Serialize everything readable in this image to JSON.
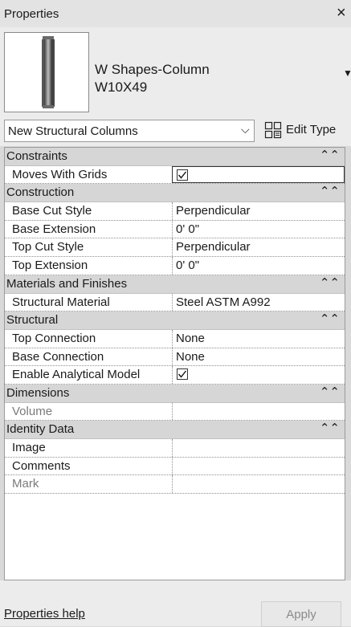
{
  "window": {
    "title": "Properties",
    "close_glyph": "×"
  },
  "type_selector": {
    "family": "W Shapes-Column",
    "type": "W10X49",
    "thumbnail_icon": "steel-column-icon",
    "arrow": "▼"
  },
  "filter": {
    "label": "New Structural Columns",
    "chevron": "⌵"
  },
  "edit_type": {
    "label": "Edit Type",
    "icon": "edit-type-icon"
  },
  "categories": [
    {
      "key": "constraints",
      "label": "Constraints",
      "collapse_glyph": "⌃⌃"
    },
    {
      "key": "construction",
      "label": "Construction",
      "collapse_glyph": "⌃⌃"
    },
    {
      "key": "materials",
      "label": "Materials and Finishes",
      "collapse_glyph": "⌃⌃"
    },
    {
      "key": "structural",
      "label": "Structural",
      "collapse_glyph": "⌃⌃"
    },
    {
      "key": "dimensions",
      "label": "Dimensions",
      "collapse_glyph": "⌃⌃"
    },
    {
      "key": "identity",
      "label": "Identity Data",
      "collapse_glyph": "⌃⌃"
    }
  ],
  "properties": {
    "moves_with_grids": {
      "name": "Moves With Grids",
      "checked": true
    },
    "base_cut_style": {
      "name": "Base Cut Style",
      "value": "Perpendicular"
    },
    "base_extension": {
      "name": "Base Extension",
      "value": "0'  0\""
    },
    "top_cut_style": {
      "name": "Top Cut Style",
      "value": "Perpendicular"
    },
    "top_extension": {
      "name": "Top Extension",
      "value": "0'  0\""
    },
    "structural_material": {
      "name": "Structural Material",
      "value": "Steel ASTM A992"
    },
    "top_connection": {
      "name": "Top Connection",
      "value": "None"
    },
    "base_connection": {
      "name": "Base Connection",
      "value": "None"
    },
    "enable_analytical_model": {
      "name": "Enable Analytical Model",
      "checked": true
    },
    "volume": {
      "name": "Volume",
      "value": ""
    },
    "image": {
      "name": "Image",
      "value": ""
    },
    "comments": {
      "name": "Comments",
      "value": ""
    },
    "mark": {
      "name": "Mark",
      "value": ""
    }
  },
  "footer": {
    "help_link": "Properties help",
    "apply_label": "Apply"
  }
}
